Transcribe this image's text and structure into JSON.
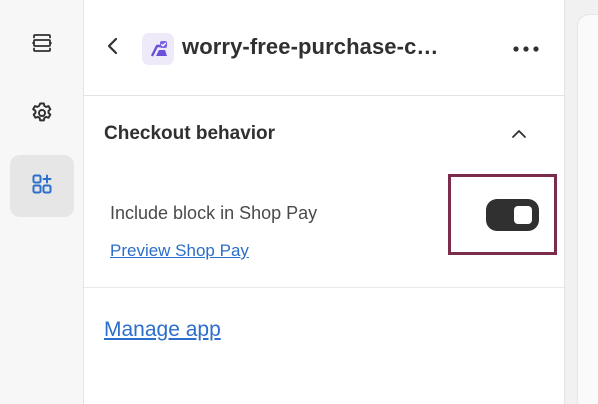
{
  "rail": {
    "items": [
      {
        "icon": "layout-sections-icon"
      },
      {
        "icon": "gear-icon"
      },
      {
        "icon": "apps-icon",
        "active": true
      }
    ]
  },
  "header": {
    "title": "worry-free-purchase-c…",
    "app_icon": "purchase-app-icon"
  },
  "section": {
    "title": "Checkout behavior",
    "toggle_label": "Include block in Shop Pay",
    "toggle_state": true,
    "preview_link": "Preview Shop Pay"
  },
  "footer": {
    "manage_link": "Manage app"
  },
  "colors": {
    "accent": "#303030",
    "link": "#2c6ecb",
    "highlight": "#7b2b4b",
    "app_icon": "#6b4fd8"
  }
}
